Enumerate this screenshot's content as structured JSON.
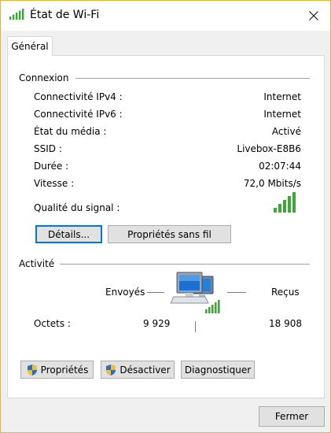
{
  "window": {
    "title": "État de Wi-Fi",
    "close_icon": "close-icon",
    "title_icon": "wifi-signal-icon"
  },
  "tabs": [
    {
      "label": "Général",
      "selected": true
    }
  ],
  "connexion": {
    "header": "Connexion",
    "rows": [
      {
        "label": "Connectivité IPv4 :",
        "value": "Internet"
      },
      {
        "label": "Connectivité IPv6 :",
        "value": "Internet"
      },
      {
        "label": "État du média :",
        "value": "Activé"
      },
      {
        "label": "SSID :",
        "value": "Livebox-E8B6"
      },
      {
        "label": "Durée :",
        "value": "02:07:44"
      },
      {
        "label": "Vitesse :",
        "value": "72,0 Mbits/s"
      }
    ],
    "signal_label": "Qualité du signal :",
    "signal_bars": 5,
    "signal_max": 5,
    "details_button": "Détails...",
    "wireless_props_button": "Propriétés sans fil"
  },
  "activite": {
    "header": "Activité",
    "sent_label": "Envoyés",
    "received_label": "Reçus",
    "bytes_label": "Octets :",
    "bytes_sent": "9 929",
    "bytes_received": "18 908",
    "network_icon": "network-computers-icon"
  },
  "actions": {
    "properties": "Propriétés",
    "disable": "Désactiver",
    "diagnose": "Diagnostiquer",
    "shield_icon": "uac-shield-icon"
  },
  "footer": {
    "close_button": "Fermer"
  },
  "colors": {
    "signal_green": "#3aa935",
    "focus_blue": "#0078d7",
    "window_border": "#e8b33c"
  }
}
